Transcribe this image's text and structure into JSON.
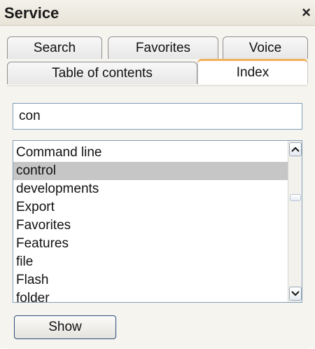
{
  "window": {
    "title": "Service",
    "close_label": "×"
  },
  "tabs": {
    "top_row": [
      {
        "label": "Search"
      },
      {
        "label": "Favorites"
      },
      {
        "label": "Voice"
      }
    ],
    "bottom_row": [
      {
        "label": "Table of contents"
      },
      {
        "label": "Index"
      }
    ],
    "selected": "Index"
  },
  "search": {
    "value": "con",
    "placeholder": ""
  },
  "list": {
    "items": [
      {
        "label": "Command line",
        "selected": false
      },
      {
        "label": "control",
        "selected": true
      },
      {
        "label": "developments",
        "selected": false
      },
      {
        "label": "Export",
        "selected": false
      },
      {
        "label": "Favorites",
        "selected": false
      },
      {
        "label": "Features",
        "selected": false
      },
      {
        "label": "file",
        "selected": false
      },
      {
        "label": "Flash",
        "selected": false
      },
      {
        "label": "folder",
        "selected": false
      }
    ]
  },
  "actions": {
    "show_label": "Show"
  },
  "colors": {
    "selected_tab_accent": "#f0b15b",
    "selected_row": "#c7c6c6",
    "button_border": "#2d4d7c"
  },
  "icons": {
    "close": "close-icon",
    "scroll_up": "chevron-up-icon",
    "scroll_down": "chevron-down-icon"
  }
}
